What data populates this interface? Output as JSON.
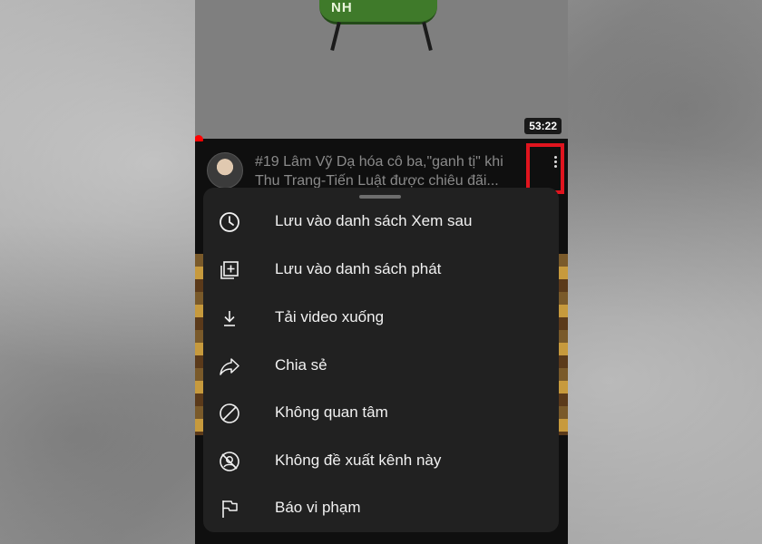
{
  "video": {
    "banner_text": "NH",
    "duration": "53:22",
    "title_line1": "#19 Lâm Vỹ Dạ hóa cô ba,\"ganh tị\" khi",
    "title_line2": "Thu Trang-Tiến Luật được chiêu đãi..."
  },
  "menu": {
    "items": [
      {
        "label": "Lưu vào danh sách Xem sau",
        "icon": "clock-icon"
      },
      {
        "label": "Lưu vào danh sách phát",
        "icon": "playlist-add-icon"
      },
      {
        "label": "Tải video xuống",
        "icon": "download-icon"
      },
      {
        "label": "Chia sẻ",
        "icon": "share-icon"
      },
      {
        "label": "Không quan tâm",
        "icon": "not-interested-icon"
      },
      {
        "label": "Không đề xuất kênh này",
        "icon": "dont-recommend-channel-icon"
      },
      {
        "label": "Báo vi phạm",
        "icon": "flag-icon"
      }
    ]
  },
  "colors": {
    "sheet_bg": "#212121",
    "highlight_border": "#e0141e",
    "progress": "#ff0000"
  }
}
